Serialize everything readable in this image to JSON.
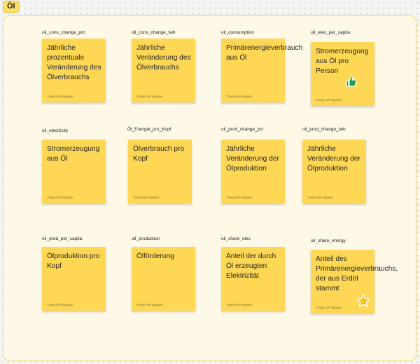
{
  "frame": {
    "title": "Öl"
  },
  "notes": [
    {
      "label": "oil_cons_change_pct",
      "text": "Jährliche prozentuale Veränderung des Ölverbrauchs",
      "author": "Trang Anh Nguyen"
    },
    {
      "label": "oil_cons_change_twh",
      "text": "Jährliche Veränderung des Ölverbrauchs",
      "author": "Trang Anh Nguyen"
    },
    {
      "label": "oil_consumption",
      "text": "Primärenergieverbrauch aus Öl",
      "author": "Trang Anh Nguyen"
    },
    {
      "label": "oil_elec_per_capita",
      "text": "Stromerzeugung aus Öl pro Person",
      "author": "Trang Anh Nguyen",
      "sticker": "thumbs-up-icon"
    },
    {
      "label": "oil_electricity",
      "text": "Stromerzeugung aus Öl",
      "author": "Trang Anh Nguyen"
    },
    {
      "label": "Öl_Energie_pro_Kopf",
      "text": "Ölverbrauch pro Kopf",
      "author": "Trang Anh Nguyen"
    },
    {
      "label": "oil_prod_change_pct",
      "text": "Jährliche Veränderung der Ölproduktion",
      "author": "Trang Anh Nguyen"
    },
    {
      "label": "oil_prod_change_twh",
      "text": "Jährliche Veränderung der Ölproduktion",
      "author": "Trang Anh Nguyen"
    },
    {
      "label": "oil_prod_per_capita",
      "text": "Ölproduktion pro Kopf",
      "author": "Trang Anh Nguyen"
    },
    {
      "label": "oil_production",
      "text": "Ölförderung",
      "author": "Trang Anh Nguyen"
    },
    {
      "label": "oil_share_elec",
      "text": "Anteil der durch Öl erzeugten Elektrizität",
      "author": "Trang Anh Nguyen"
    },
    {
      "label": "oil_share_energy",
      "text": "Anteil des Primärenergieverbrauchs, der aus Erdöl stammt",
      "author": "Trang Anh Nguyen",
      "sticker": "star-icon"
    }
  ],
  "colors": {
    "note": "#fed754",
    "frame_bg": "#fef8e6",
    "thumbs_up": "#1e9e55",
    "star": "#f5c518"
  }
}
